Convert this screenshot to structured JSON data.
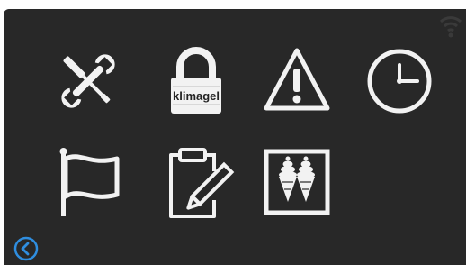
{
  "screen": {
    "background": "#282828",
    "icon_color": "#f2f2f2",
    "accent": "#2f8ee0"
  },
  "status_bar": {
    "icon": "wifi-icon"
  },
  "menu": {
    "items": [
      {
        "id": "service",
        "icon": "wrench-screwdriver-icon"
      },
      {
        "id": "lock",
        "icon": "padlock-icon",
        "label": "klimagel"
      },
      {
        "id": "warnings",
        "icon": "warning-triangle-icon"
      },
      {
        "id": "clock",
        "icon": "clock-icon"
      },
      {
        "id": "language",
        "icon": "flag-icon"
      },
      {
        "id": "notes",
        "icon": "clipboard-pencil-icon"
      },
      {
        "id": "product",
        "icon": "ice-cream-cones-icon"
      }
    ]
  },
  "nav": {
    "back_icon": "back-arrow-icon"
  }
}
